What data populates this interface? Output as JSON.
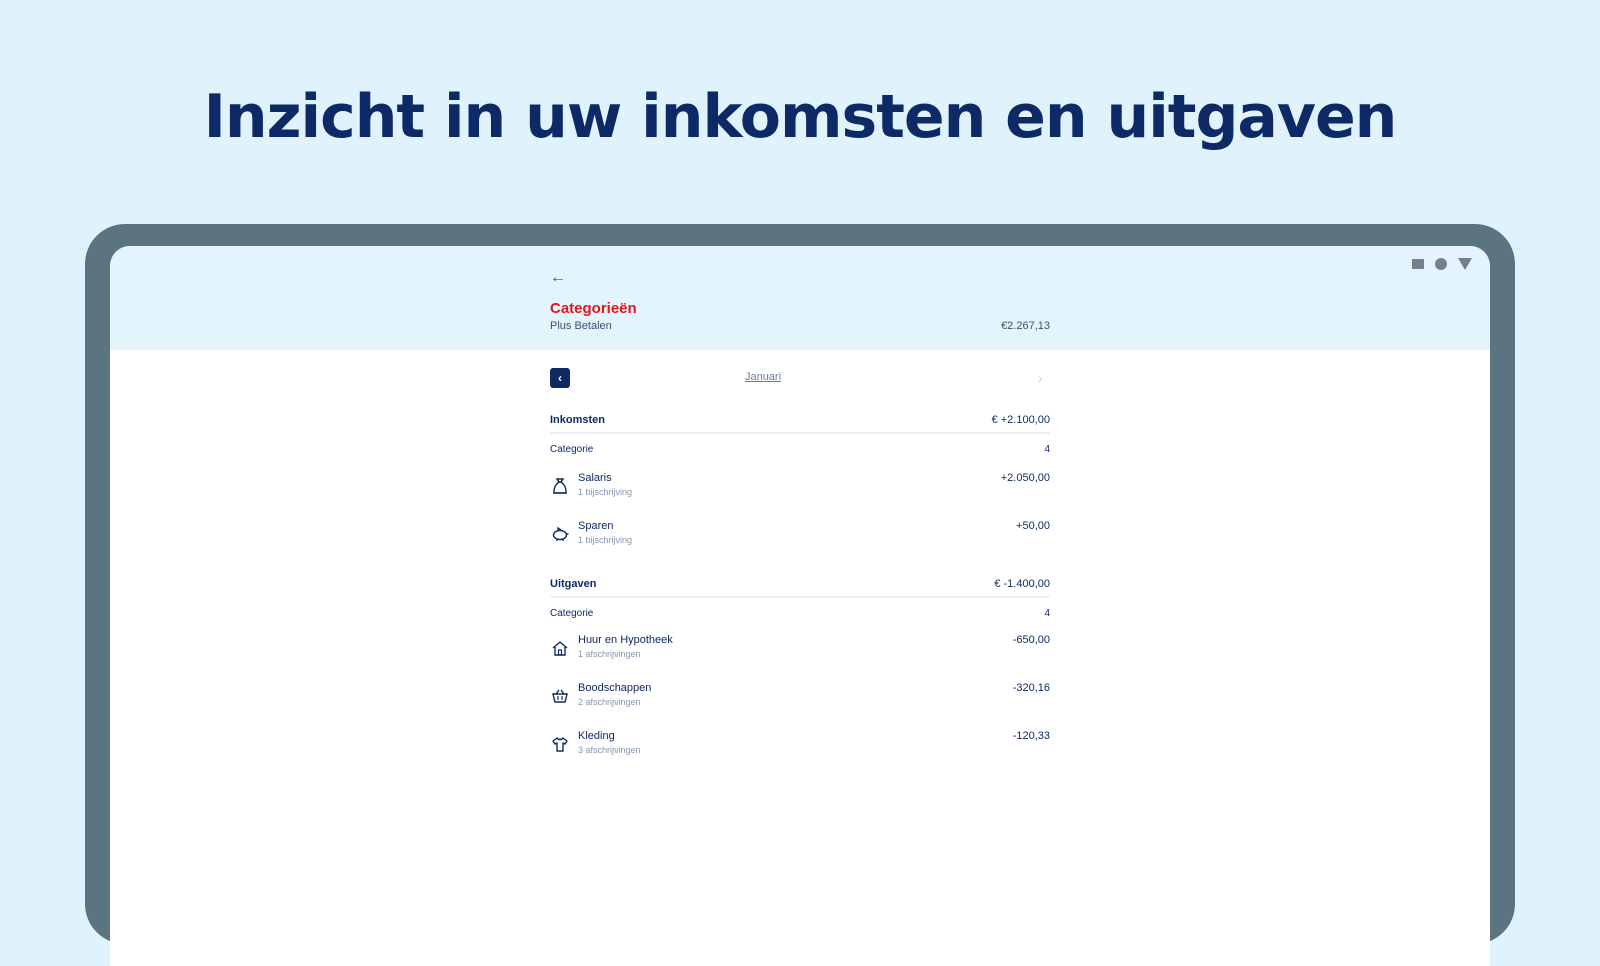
{
  "headline": "Inzicht in uw inkomsten en uitgaven",
  "header": {
    "back_glyph": "←",
    "title": "Categorieën",
    "account": "Plus Betalen",
    "balance": "€2.267,13"
  },
  "month": {
    "prev_glyph": "‹",
    "label": "Januari",
    "next_glyph": "›"
  },
  "income": {
    "label": "Inkomsten",
    "total": "€ +2.100,00",
    "category_label": "Categorie",
    "count": "4",
    "items": [
      {
        "name": "Salaris",
        "meta": "1 bijschrijving",
        "amount": "+2.050,00",
        "icon": "money-bag-icon"
      },
      {
        "name": "Sparen",
        "meta": "1 bijschrijving",
        "amount": "+50,00",
        "icon": "piggy-bank-icon"
      }
    ]
  },
  "expenses": {
    "label": "Uitgaven",
    "total": "€ -1.400,00",
    "category_label": "Categorie",
    "count": "4",
    "items": [
      {
        "name": "Huur en Hypotheek",
        "meta": "1 afschrijvingen",
        "amount": "-650,00",
        "icon": "house-icon"
      },
      {
        "name": "Boodschappen",
        "meta": "2 afschrijvingen",
        "amount": "-320,16",
        "icon": "shopping-basket-icon"
      },
      {
        "name": "Kleding",
        "meta": "3 afschrijvingen",
        "amount": "-120,33",
        "icon": "shirt-icon"
      }
    ]
  },
  "colors": {
    "page_bg": "#e0f3fd",
    "headline": "#0d2a66",
    "title_red": "#e1161b",
    "navy": "#0f2a63",
    "tablet_frame": "#5b7480"
  }
}
